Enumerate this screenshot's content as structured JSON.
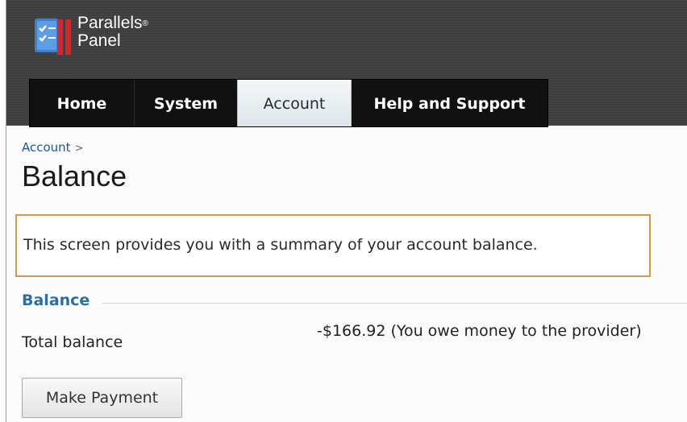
{
  "header": {
    "brand_line1": "Parallels",
    "brand_mark": "®",
    "brand_line2": "Panel",
    "logo_icon": "checklist-icon"
  },
  "nav": {
    "tabs": [
      {
        "label": "Home",
        "active": false
      },
      {
        "label": "System",
        "active": false
      },
      {
        "label": "Account",
        "active": true
      },
      {
        "label": "Help and Support",
        "active": false
      }
    ]
  },
  "breadcrumb": {
    "items": [
      "Account"
    ],
    "separator": ">"
  },
  "page": {
    "title": "Balance",
    "hint": "This screen provides you with a summary of your account balance."
  },
  "balance_section": {
    "title": "Balance",
    "total_label": "Total balance",
    "total_value": "-$166.92 (You owe money to the provider)"
  },
  "actions": {
    "make_payment_label": "Make Payment"
  },
  "colors": {
    "link": "#1d56a0",
    "section_title": "#2c6f9f",
    "hint_border": "#d39a4a",
    "header_bg": "#404040"
  }
}
